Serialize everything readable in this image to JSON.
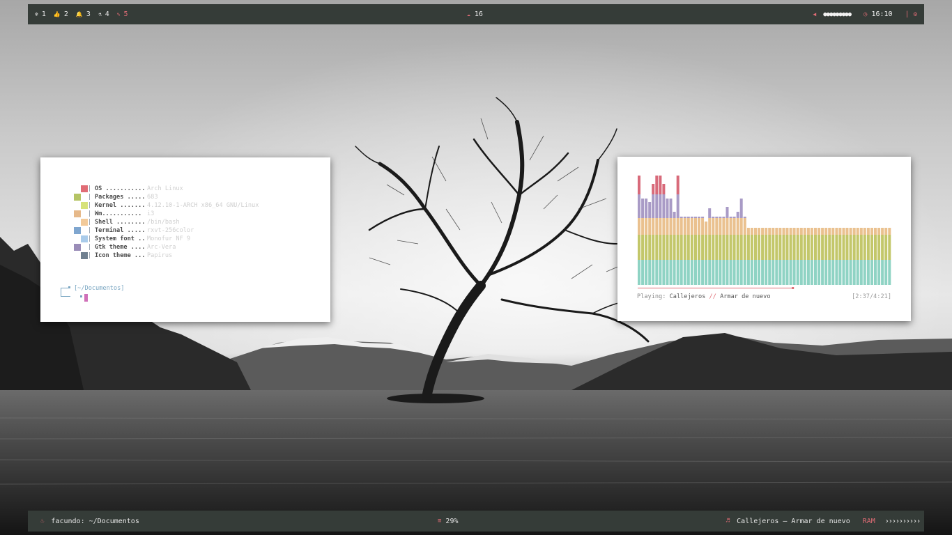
{
  "colors": {
    "bar_bg": "#353c38",
    "accent": "#e06c75",
    "palette": [
      "#e06c75",
      "#b5c465",
      "#d7e27a",
      "#e6b98a",
      "#f2ca9a",
      "#7fa6cf",
      "#a9cbea",
      "#9a8db8",
      "#708090"
    ]
  },
  "top_bar": {
    "workspaces": [
      {
        "icon": "snowflake-icon",
        "glyph": "❄",
        "label": "1",
        "active": false
      },
      {
        "icon": "thumbs-up-icon",
        "glyph": "👍",
        "label": "2",
        "active": false
      },
      {
        "icon": "bell-icon",
        "glyph": "🔔",
        "label": "3",
        "active": false
      },
      {
        "icon": "flask-icon",
        "glyph": "⚗",
        "label": "4",
        "active": false
      },
      {
        "icon": "pencil-icon",
        "glyph": "✎",
        "label": "5",
        "active": true
      }
    ],
    "center": {
      "icon": "cloud-icon",
      "glyph": "☁",
      "label": "16"
    },
    "volume": {
      "icon": "volume-icon",
      "glyph": "◀",
      "dots": "●●●●●●●●●"
    },
    "clock": {
      "icon": "clock-icon",
      "glyph": "◷",
      "time": "16:10"
    },
    "separator": "|",
    "settings": {
      "icon": "gear-icon",
      "glyph": "⚙"
    }
  },
  "bottom_bar": {
    "left": {
      "icon": "fire-icon",
      "glyph": "♨",
      "label": "facundo: ~/Documentos"
    },
    "center": {
      "icon": "cpu-icon",
      "glyph": "≡",
      "label": "29%"
    },
    "music": {
      "icon": "music-note-icon",
      "glyph": "♬",
      "label": "Callejeros – Armar de nuevo"
    },
    "ram": {
      "label": "RAM",
      "bar": "››››››››››"
    }
  },
  "terminal": {
    "fetch": [
      {
        "key": "OS ...........",
        "value": "Arch Linux",
        "color": "#e06c75",
        "offset": 1
      },
      {
        "key": "Packages .....",
        "value": "683",
        "color": "#b5c465",
        "offset": 0
      },
      {
        "key": "Kernel .......",
        "value": "4.12.10-1-ARCH x86_64 GNU/Linux",
        "color": "#d7e27a",
        "offset": 1
      },
      {
        "key": "Wm...........",
        "value": "i3",
        "color": "#e6b98a",
        "offset": 0
      },
      {
        "key": "Shell ........",
        "value": "/bin/bash",
        "color": "#f2ca9a",
        "offset": 1
      },
      {
        "key": "Terminal .....",
        "value": "rxvt-256color",
        "color": "#7fa6cf",
        "offset": 0
      },
      {
        "key": "System font ..",
        "value": "Monofur NF 9",
        "color": "#a9cbea",
        "offset": 1
      },
      {
        "key": "Gtk theme ....",
        "value": "Arc-Vera",
        "color": "#9a8db8",
        "offset": 0
      },
      {
        "key": "Icon theme ...",
        "value": "Papirus",
        "color": "#708090",
        "offset": 1
      }
    ],
    "pipe": "|",
    "prompt_path": "[~/Documentos]"
  },
  "music": {
    "playing_label": "Playing:",
    "artist": "Callejeros",
    "separator": "//",
    "title": "Armar de nuevo",
    "time": "[2:37/4:21]",
    "progress": 0.6,
    "spectrum": [
      157,
      124,
      124,
      119,
      145,
      157,
      157,
      145,
      124,
      124,
      105,
      157,
      98,
      98,
      98,
      98,
      98,
      98,
      98,
      91,
      110,
      98,
      98,
      98,
      98,
      112,
      98,
      98,
      105,
      124,
      98,
      82,
      82,
      82,
      82,
      82,
      82,
      82,
      82,
      82,
      82,
      82,
      82,
      82,
      82,
      82,
      82,
      82,
      82,
      82,
      82,
      82,
      82,
      82,
      82,
      82,
      82,
      82,
      82,
      82,
      82,
      82,
      82,
      82,
      82,
      82,
      82,
      82,
      82,
      82,
      82,
      82
    ]
  }
}
